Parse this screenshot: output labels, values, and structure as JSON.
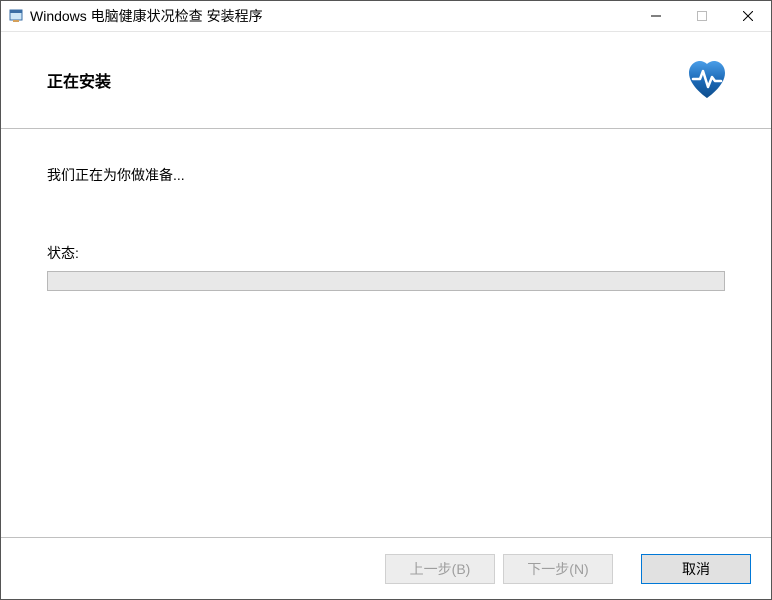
{
  "window": {
    "title": "Windows 电脑健康状况检查 安装程序"
  },
  "header": {
    "title": "正在安装"
  },
  "content": {
    "message": "我们正在为你做准备...",
    "status_label": "状态:"
  },
  "footer": {
    "back_label": "上一步(B)",
    "next_label": "下一步(N)",
    "cancel_label": "取消"
  }
}
